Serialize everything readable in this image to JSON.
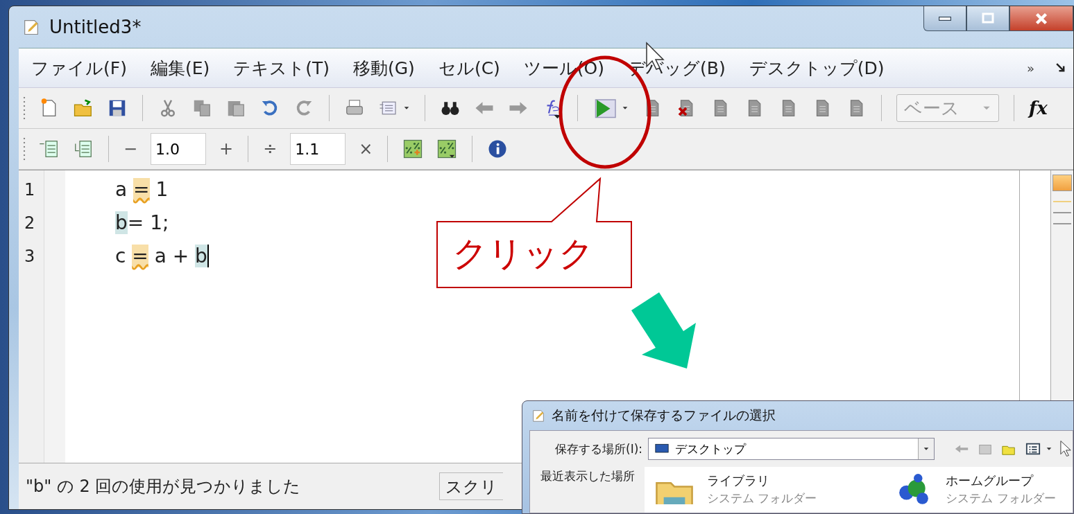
{
  "window": {
    "title": "Untitled3*"
  },
  "menu": [
    "ファイル(F)",
    "編集(E)",
    "テキスト(T)",
    "移動(G)",
    "セル(C)",
    "ツール(O)",
    "デバッグ(B)",
    "デスクトップ(D)"
  ],
  "menu_overflow": "»",
  "toolbar": {
    "workspace_dropdown": "ベース",
    "function_button": "fx"
  },
  "toolbar2": {
    "minus": "−",
    "field_1": "1.0",
    "plus": "+",
    "divide": "÷",
    "field_2": "1.1",
    "times": "×"
  },
  "editor": {
    "lines": [
      {
        "number": "1",
        "caret": false,
        "tokens": [
          {
            "text": "a ",
            "kind": "plain"
          },
          {
            "text": "=",
            "kind": "warning"
          },
          {
            "text": " 1",
            "kind": "plain"
          }
        ]
      },
      {
        "number": "2",
        "caret": false,
        "tokens": [
          {
            "text": "b",
            "kind": "reference"
          },
          {
            "text": "= 1;",
            "kind": "plain"
          }
        ]
      },
      {
        "number": "3",
        "caret": true,
        "tokens": [
          {
            "text": "c ",
            "kind": "plain"
          },
          {
            "text": "=",
            "kind": "warning"
          },
          {
            "text": " a + ",
            "kind": "plain"
          },
          {
            "text": "b",
            "kind": "reference"
          }
        ]
      }
    ]
  },
  "status_bar": {
    "message": "\"b\" の 2 回の使用が見つかりました",
    "mode": "スクリ"
  },
  "annotation": {
    "callout": "クリック"
  },
  "dialog": {
    "title": "名前を付けて保存するファイルの選択",
    "location_label": "保存する場所(I):",
    "location": "デスクトップ",
    "places": [
      "最近表示した場所"
    ],
    "items": [
      {
        "name": "ライブラリ",
        "type": "システム フォルダー"
      },
      {
        "name": "ホームグループ",
        "type": "システム フォルダー"
      }
    ]
  }
}
